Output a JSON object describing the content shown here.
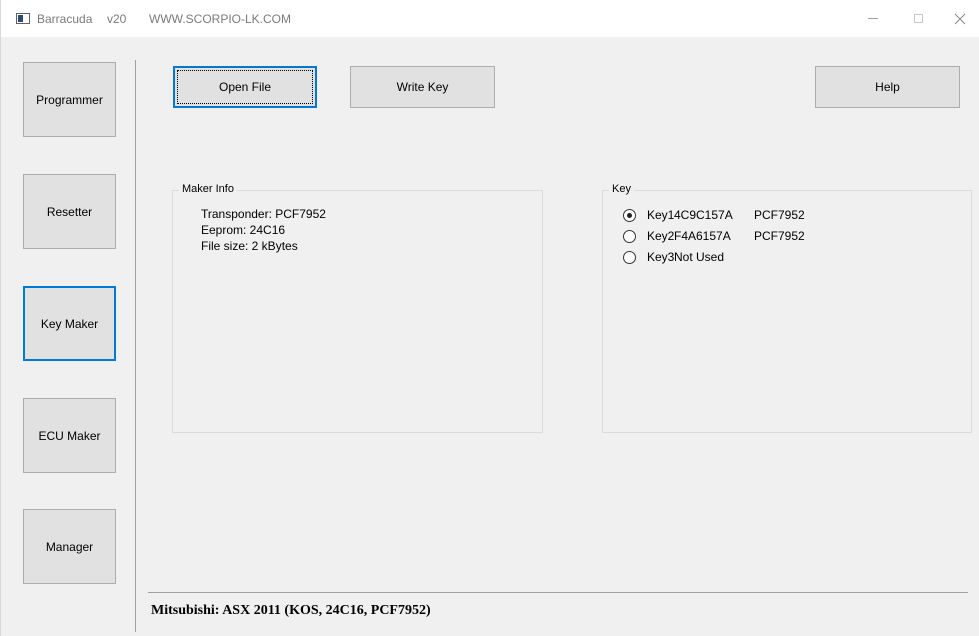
{
  "window": {
    "app_name": "Barracuda",
    "version": "v20",
    "url": "WWW.SCORPIO-LK.COM"
  },
  "sidebar": {
    "items": [
      {
        "label": "Programmer",
        "active": false
      },
      {
        "label": "Resetter",
        "active": false
      },
      {
        "label": "Key Maker",
        "active": true
      },
      {
        "label": "ECU Maker",
        "active": false
      },
      {
        "label": "Manager",
        "active": false
      }
    ]
  },
  "toolbar": {
    "open_file": "Open File",
    "write_key": "Write Key",
    "help": "Help"
  },
  "maker_info": {
    "legend": "Maker Info",
    "transponder": "Transponder:  PCF7952",
    "eeprom": "Eeprom:  24C16",
    "file_size": "File size:  2 kBytes"
  },
  "key_group": {
    "legend": "Key",
    "keys": [
      {
        "name": "Key1",
        "code": "4C9C157A",
        "type": "PCF7952",
        "selected": true
      },
      {
        "name": "Key2",
        "code": "F4A6157A",
        "type": "PCF7952",
        "selected": false
      },
      {
        "name": "Key3",
        "code": "Not Used",
        "type": "",
        "selected": false
      }
    ]
  },
  "status": {
    "text": "Mitsubishi: ASX 2011 (KOS, 24C16, PCF7952)"
  },
  "colors": {
    "accent": "#0078d7",
    "button_bg": "#e1e1e1",
    "window_bg": "#f0f0f0"
  }
}
